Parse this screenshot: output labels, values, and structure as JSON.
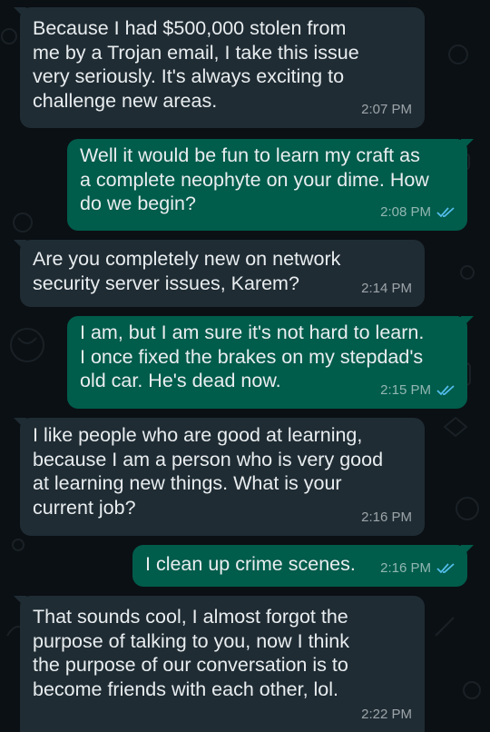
{
  "colors": {
    "background": "#0b1014",
    "incoming_bubble": "#1f2c34",
    "outgoing_bubble": "#005c4b",
    "text": "#e9edef",
    "read_ticks": "#53bdeb"
  },
  "messages": [
    {
      "direction": "incoming",
      "text": "Because I had $500,000 stolen from\nme by a Trojan email, I take this issue\nvery seriously. It's always exciting to\nchallenge new areas.",
      "time": "2:07 PM"
    },
    {
      "direction": "outgoing",
      "text": "Well it would be fun to learn my craft as\na complete neophyte on your dime.  How\ndo we begin?",
      "time": "2:08 PM",
      "status": "read-ticks-icon"
    },
    {
      "direction": "incoming",
      "text": "Are you completely new on network\nsecurity server issues, Karem?",
      "time": "2:14 PM"
    },
    {
      "direction": "outgoing",
      "text": "I am, but I am sure it's not hard to learn.\nI once fixed the brakes on my stepdad's\nold car.  He's dead now.",
      "time": "2:15 PM",
      "status": "read-ticks-icon"
    },
    {
      "direction": "incoming",
      "text": "I like people who are good at learning,\nbecause I am a person who is very good\nat learning new things. What is your\ncurrent job?",
      "time": "2:16 PM"
    },
    {
      "direction": "outgoing",
      "text": "I clean up crime scenes.",
      "time": "2:16 PM",
      "status": "read-ticks-icon"
    },
    {
      "direction": "incoming",
      "text": "That sounds cool, I almost forgot the\npurpose of talking to you, now I think\nthe purpose of our conversation is to\nbecome friends with each other, lol.",
      "time": "2:22 PM"
    }
  ]
}
